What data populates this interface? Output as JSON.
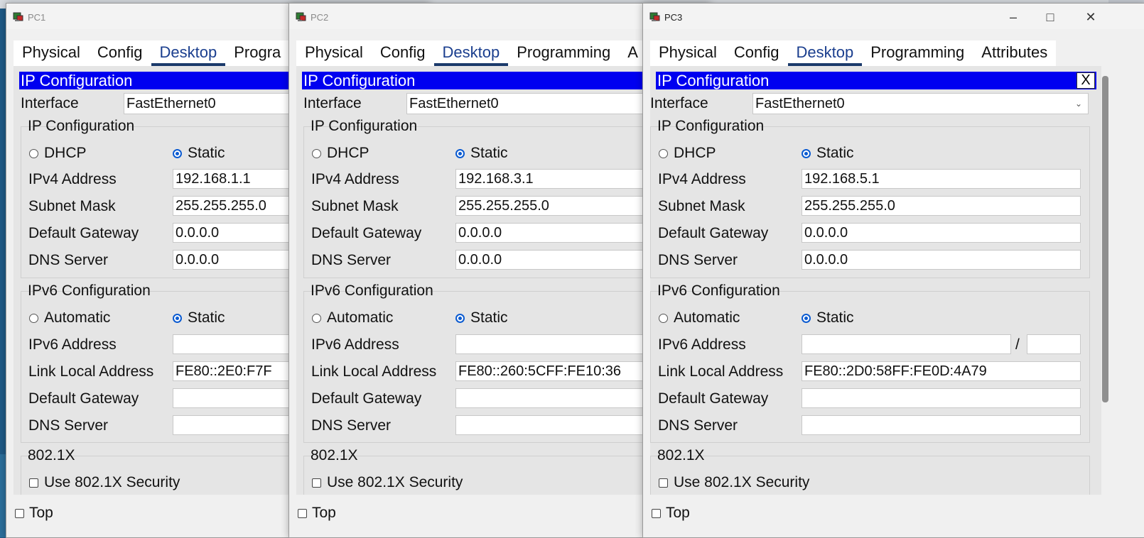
{
  "windows": [
    {
      "title": "PC1",
      "tabs": [
        "Physical",
        "Config",
        "Desktop",
        "Progra"
      ],
      "active_tab": "Desktop",
      "panel_title": "IP Configuration",
      "interface_label": "Interface",
      "interface_value": "FastEthernet0",
      "ipv4": {
        "section_title": "IP Configuration",
        "dhcp_label": "DHCP",
        "static_label": "Static",
        "selected": "Static",
        "address_label": "IPv4 Address",
        "address": "192.168.1.1",
        "mask_label": "Subnet Mask",
        "mask": "255.255.255.0",
        "gateway_label": "Default Gateway",
        "gateway": "0.0.0.0",
        "dns_label": "DNS Server",
        "dns": "0.0.0.0"
      },
      "ipv6": {
        "section_title": "IPv6 Configuration",
        "auto_label": "Automatic",
        "static_label": "Static",
        "selected": "Static",
        "address_label": "IPv6 Address",
        "address": "",
        "link_local_label": "Link Local Address",
        "link_local": "FE80::2E0:F7F",
        "gateway_label": "Default Gateway",
        "gateway": "",
        "dns_label": "DNS Server",
        "dns": ""
      },
      "dot1x": {
        "section_title": "802.1X",
        "use_label": "Use 802.1X Security",
        "checked": false
      },
      "top_label": "Top"
    },
    {
      "title": "PC2",
      "tabs": [
        "Physical",
        "Config",
        "Desktop",
        "Programming",
        "A"
      ],
      "active_tab": "Desktop",
      "panel_title": "IP Configuration",
      "interface_label": "Interface",
      "interface_value": "FastEthernet0",
      "ipv4": {
        "section_title": "IP Configuration",
        "dhcp_label": "DHCP",
        "static_label": "Static",
        "selected": "Static",
        "address_label": "IPv4 Address",
        "address": "192.168.3.1",
        "mask_label": "Subnet Mask",
        "mask": "255.255.255.0",
        "gateway_label": "Default Gateway",
        "gateway": "0.0.0.0",
        "dns_label": "DNS Server",
        "dns": "0.0.0.0"
      },
      "ipv6": {
        "section_title": "IPv6 Configuration",
        "auto_label": "Automatic",
        "static_label": "Static",
        "selected": "Static",
        "address_label": "IPv6 Address",
        "address": "",
        "link_local_label": "Link Local Address",
        "link_local": "FE80::260:5CFF:FE10:36",
        "gateway_label": "Default Gateway",
        "gateway": "",
        "dns_label": "DNS Server",
        "dns": ""
      },
      "dot1x": {
        "section_title": "802.1X",
        "use_label": "Use 802.1X Security",
        "checked": false
      },
      "top_label": "Top"
    },
    {
      "title": "PC3",
      "tabs": [
        "Physical",
        "Config",
        "Desktop",
        "Programming",
        "Attributes"
      ],
      "active_tab": "Desktop",
      "panel_title": "IP Configuration",
      "close_label": "X",
      "interface_label": "Interface",
      "interface_value": "FastEthernet0",
      "ipv4": {
        "section_title": "IP Configuration",
        "dhcp_label": "DHCP",
        "static_label": "Static",
        "selected": "Static",
        "address_label": "IPv4 Address",
        "address": "192.168.5.1",
        "mask_label": "Subnet Mask",
        "mask": "255.255.255.0",
        "gateway_label": "Default Gateway",
        "gateway": "0.0.0.0",
        "dns_label": "DNS Server",
        "dns": "0.0.0.0"
      },
      "ipv6": {
        "section_title": "IPv6 Configuration",
        "auto_label": "Automatic",
        "static_label": "Static",
        "selected": "Static",
        "address_label": "IPv6 Address",
        "address": "",
        "prefix_separator": "/",
        "prefix": "",
        "link_local_label": "Link Local Address",
        "link_local": "FE80::2D0:58FF:FE0D:4A79",
        "gateway_label": "Default Gateway",
        "gateway": "",
        "dns_label": "DNS Server",
        "dns": ""
      },
      "dot1x": {
        "section_title": "802.1X",
        "use_label": "Use 802.1X Security",
        "checked": false
      },
      "top_label": "Top",
      "caption_buttons": [
        "minimize",
        "maximize",
        "close"
      ]
    }
  ],
  "icons": {
    "app": "packet-tracer-pc-icon",
    "minimize": "minimize-icon",
    "maximize": "maximize-icon",
    "close": "close-icon",
    "interface_dropdown": "chevron-down-icon"
  },
  "colors": {
    "panel_header_bg": "#0000f0",
    "active_tab_underline": "#1b3a6b",
    "radio_selected": "#0b5bd1",
    "desktop_bg": "#1f5a86"
  }
}
